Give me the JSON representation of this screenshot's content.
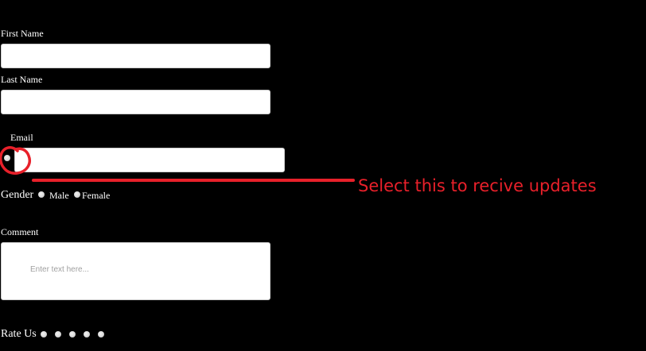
{
  "form": {
    "first_name": {
      "label": "First Name",
      "value": ""
    },
    "last_name": {
      "label": "Last Name",
      "value": ""
    },
    "email": {
      "label": "Email",
      "value": "",
      "option_selected": false
    },
    "gender": {
      "label": "Gender",
      "options": [
        {
          "label": "Male",
          "selected": false
        },
        {
          "label": "Female",
          "selected": false
        }
      ]
    },
    "comment": {
      "label": "Comment",
      "value": "",
      "placeholder": "Enter text here..."
    },
    "rate": {
      "label": "Rate Us",
      "options_count": 5,
      "selected": null
    }
  },
  "annotation": {
    "text": "Select this to recive updates",
    "color": "#e8202a"
  },
  "colors": {
    "background": "#000000",
    "text": "#ffffff",
    "input_background": "#ffffff"
  }
}
